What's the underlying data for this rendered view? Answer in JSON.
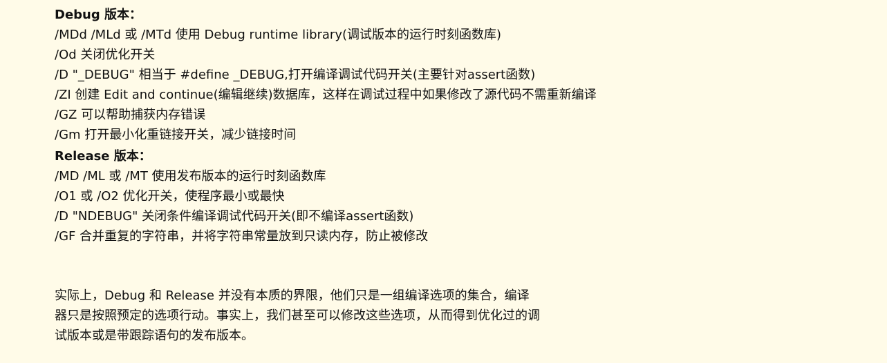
{
  "debug": {
    "heading": "Debug 版本：",
    "lines": [
      "/MDd /MLd 或 /MTd 使用 Debug runtime library(调试版本的运行时刻函数库)",
      "/Od 关闭优化开关",
      "/D \"_DEBUG\" 相当于 #define _DEBUG,打开编译调试代码开关(主要针对assert函数)",
      "/ZI 创建 Edit and continue(编辑继续)数据库，这样在调试过程中如果修改了源代码不需重新编译",
      "/GZ 可以帮助捕获内存错误",
      "/Gm 打开最小化重链接开关，减少链接时间"
    ]
  },
  "release": {
    "heading": "Release 版本：",
    "lines": [
      "/MD /ML 或 /MT 使用发布版本的运行时刻函数库",
      "/O1 或 /O2 优化开关，使程序最小或最快",
      "/D \"NDEBUG\" 关闭条件编译调试代码开关(即不编译assert函数)",
      "/GF 合并重复的字符串，并将字符串常量放到只读内存，防止被修改"
    ]
  },
  "summary": {
    "lines": [
      "实际上，Debug 和 Release 并没有本质的界限，他们只是一组编译选项的集合，编译",
      "器只是按照预定的选项行动。事实上，我们甚至可以修改这些选项，从而得到优化过的调",
      "试版本或是带跟踪语句的发布版本。"
    ]
  }
}
